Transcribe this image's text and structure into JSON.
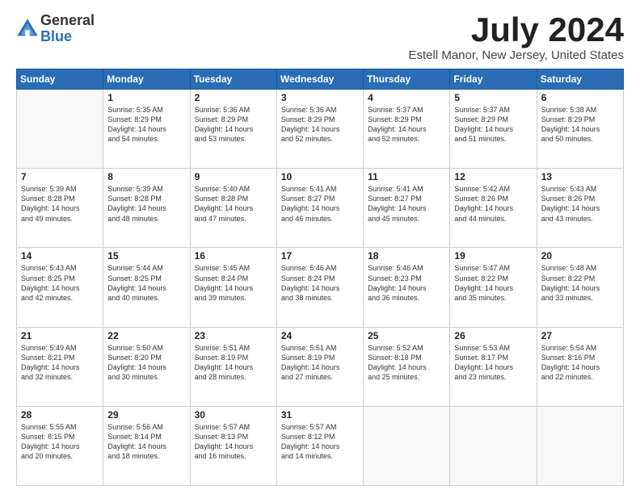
{
  "logo": {
    "general": "General",
    "blue": "Blue"
  },
  "title": "July 2024",
  "location": "Estell Manor, New Jersey, United States",
  "headers": [
    "Sunday",
    "Monday",
    "Tuesday",
    "Wednesday",
    "Thursday",
    "Friday",
    "Saturday"
  ],
  "weeks": [
    [
      {
        "day": "",
        "info": ""
      },
      {
        "day": "1",
        "info": "Sunrise: 5:35 AM\nSunset: 8:29 PM\nDaylight: 14 hours\nand 54 minutes."
      },
      {
        "day": "2",
        "info": "Sunrise: 5:36 AM\nSunset: 8:29 PM\nDaylight: 14 hours\nand 53 minutes."
      },
      {
        "day": "3",
        "info": "Sunrise: 5:36 AM\nSunset: 8:29 PM\nDaylight: 14 hours\nand 52 minutes."
      },
      {
        "day": "4",
        "info": "Sunrise: 5:37 AM\nSunset: 8:29 PM\nDaylight: 14 hours\nand 52 minutes."
      },
      {
        "day": "5",
        "info": "Sunrise: 5:37 AM\nSunset: 8:29 PM\nDaylight: 14 hours\nand 51 minutes."
      },
      {
        "day": "6",
        "info": "Sunrise: 5:38 AM\nSunset: 8:29 PM\nDaylight: 14 hours\nand 50 minutes."
      }
    ],
    [
      {
        "day": "7",
        "info": "Sunrise: 5:39 AM\nSunset: 8:28 PM\nDaylight: 14 hours\nand 49 minutes."
      },
      {
        "day": "8",
        "info": "Sunrise: 5:39 AM\nSunset: 8:28 PM\nDaylight: 14 hours\nand 48 minutes."
      },
      {
        "day": "9",
        "info": "Sunrise: 5:40 AM\nSunset: 8:28 PM\nDaylight: 14 hours\nand 47 minutes."
      },
      {
        "day": "10",
        "info": "Sunrise: 5:41 AM\nSunset: 8:27 PM\nDaylight: 14 hours\nand 46 minutes."
      },
      {
        "day": "11",
        "info": "Sunrise: 5:41 AM\nSunset: 8:27 PM\nDaylight: 14 hours\nand 45 minutes."
      },
      {
        "day": "12",
        "info": "Sunrise: 5:42 AM\nSunset: 8:26 PM\nDaylight: 14 hours\nand 44 minutes."
      },
      {
        "day": "13",
        "info": "Sunrise: 5:43 AM\nSunset: 8:26 PM\nDaylight: 14 hours\nand 43 minutes."
      }
    ],
    [
      {
        "day": "14",
        "info": "Sunrise: 5:43 AM\nSunset: 8:25 PM\nDaylight: 14 hours\nand 42 minutes."
      },
      {
        "day": "15",
        "info": "Sunrise: 5:44 AM\nSunset: 8:25 PM\nDaylight: 14 hours\nand 40 minutes."
      },
      {
        "day": "16",
        "info": "Sunrise: 5:45 AM\nSunset: 8:24 PM\nDaylight: 14 hours\nand 39 minutes."
      },
      {
        "day": "17",
        "info": "Sunrise: 5:46 AM\nSunset: 8:24 PM\nDaylight: 14 hours\nand 38 minutes."
      },
      {
        "day": "18",
        "info": "Sunrise: 5:46 AM\nSunset: 8:23 PM\nDaylight: 14 hours\nand 36 minutes."
      },
      {
        "day": "19",
        "info": "Sunrise: 5:47 AM\nSunset: 8:22 PM\nDaylight: 14 hours\nand 35 minutes."
      },
      {
        "day": "20",
        "info": "Sunrise: 5:48 AM\nSunset: 8:22 PM\nDaylight: 14 hours\nand 33 minutes."
      }
    ],
    [
      {
        "day": "21",
        "info": "Sunrise: 5:49 AM\nSunset: 8:21 PM\nDaylight: 14 hours\nand 32 minutes."
      },
      {
        "day": "22",
        "info": "Sunrise: 5:50 AM\nSunset: 8:20 PM\nDaylight: 14 hours\nand 30 minutes."
      },
      {
        "day": "23",
        "info": "Sunrise: 5:51 AM\nSunset: 8:19 PM\nDaylight: 14 hours\nand 28 minutes."
      },
      {
        "day": "24",
        "info": "Sunrise: 5:51 AM\nSunset: 8:19 PM\nDaylight: 14 hours\nand 27 minutes."
      },
      {
        "day": "25",
        "info": "Sunrise: 5:52 AM\nSunset: 8:18 PM\nDaylight: 14 hours\nand 25 minutes."
      },
      {
        "day": "26",
        "info": "Sunrise: 5:53 AM\nSunset: 8:17 PM\nDaylight: 14 hours\nand 23 minutes."
      },
      {
        "day": "27",
        "info": "Sunrise: 5:54 AM\nSunset: 8:16 PM\nDaylight: 14 hours\nand 22 minutes."
      }
    ],
    [
      {
        "day": "28",
        "info": "Sunrise: 5:55 AM\nSunset: 8:15 PM\nDaylight: 14 hours\nand 20 minutes."
      },
      {
        "day": "29",
        "info": "Sunrise: 5:56 AM\nSunset: 8:14 PM\nDaylight: 14 hours\nand 18 minutes."
      },
      {
        "day": "30",
        "info": "Sunrise: 5:57 AM\nSunset: 8:13 PM\nDaylight: 14 hours\nand 16 minutes."
      },
      {
        "day": "31",
        "info": "Sunrise: 5:57 AM\nSunset: 8:12 PM\nDaylight: 14 hours\nand 14 minutes."
      },
      {
        "day": "",
        "info": ""
      },
      {
        "day": "",
        "info": ""
      },
      {
        "day": "",
        "info": ""
      }
    ]
  ]
}
